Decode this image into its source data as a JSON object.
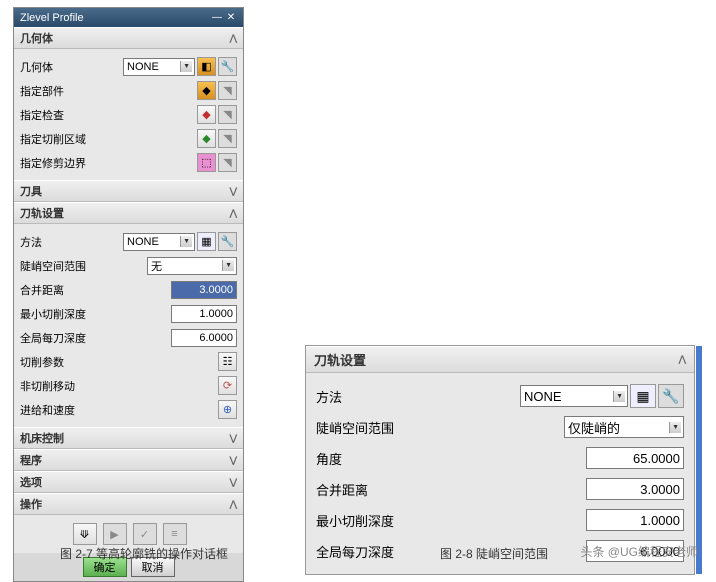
{
  "dialog": {
    "title": "Zlevel Profile",
    "sections": {
      "geometry": {
        "header": "几何体",
        "rows": {
          "geom": {
            "label": "几何体",
            "value": "NONE"
          },
          "part": {
            "label": "指定部件"
          },
          "check": {
            "label": "指定检查"
          },
          "cutarea": {
            "label": "指定切削区域"
          },
          "trim": {
            "label": "指定修剪边界"
          }
        }
      },
      "tool": {
        "header": "刀具"
      },
      "path": {
        "header": "刀轨设置",
        "rows": {
          "method": {
            "label": "方法",
            "value": "NONE"
          },
          "steep": {
            "label": "陡峭空间范围",
            "value": "无"
          },
          "merge": {
            "label": "合并距离",
            "value": "3.0000"
          },
          "mindepth": {
            "label": "最小切削深度",
            "value": "1.0000"
          },
          "global": {
            "label": "全局每刀深度",
            "value": "6.0000"
          },
          "cutparam": {
            "label": "切削参数"
          },
          "noncut": {
            "label": "非切削移动"
          },
          "feed": {
            "label": "进给和速度"
          }
        }
      },
      "machine": {
        "header": "机床控制"
      },
      "program": {
        "header": "程序"
      },
      "option": {
        "header": "选项"
      },
      "op": {
        "header": "操作"
      }
    },
    "buttons": {
      "ok": "确定",
      "cancel": "取消"
    }
  },
  "panel2": {
    "header": "刀轨设置",
    "rows": {
      "method": {
        "label": "方法",
        "value": "NONE"
      },
      "steep": {
        "label": "陡峭空间范围",
        "value": "仅陡峭的"
      },
      "angle": {
        "label": "角度",
        "value": "65.0000"
      },
      "merge": {
        "label": "合并距离",
        "value": "3.0000"
      },
      "mindepth": {
        "label": "最小切削深度",
        "value": "1.0000"
      },
      "global": {
        "label": "全局每刀深度",
        "value": "6.0000"
      }
    }
  },
  "captions": {
    "left": "图 2-7 等高轮廓铣的操作对话框",
    "right": "图 2-8 陡峭空间范围",
    "watermark": "头条 @UG编程安老师"
  }
}
